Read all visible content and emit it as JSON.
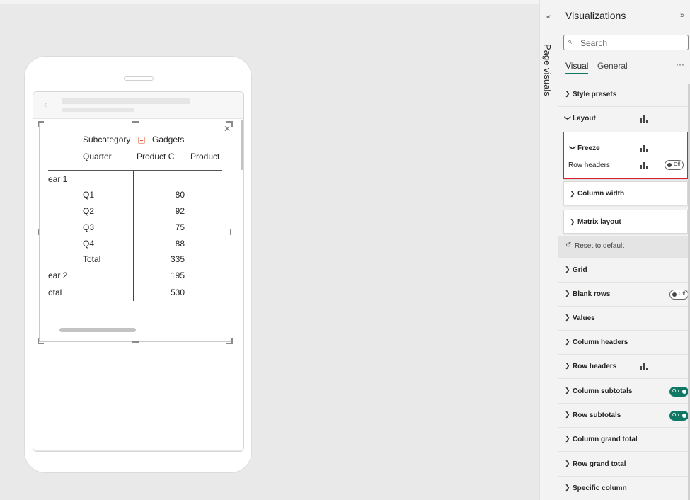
{
  "canvas": {
    "matrix": {
      "subcategory_label": "Subcategory",
      "subcategory_value": "Gadgets",
      "row_header_label": "Quarter",
      "columns": [
        "Product C",
        "Product"
      ],
      "rows": [
        {
          "label": "ear 1",
          "value": ""
        },
        {
          "label": "Q1",
          "value": "80"
        },
        {
          "label": "Q2",
          "value": "92"
        },
        {
          "label": "Q3",
          "value": "75"
        },
        {
          "label": "Q4",
          "value": "88"
        },
        {
          "label": "Total",
          "value": "335"
        },
        {
          "label": "ear 2",
          "value": "195"
        },
        {
          "label": "otal",
          "value": "530"
        }
      ]
    }
  },
  "rail": {
    "label": "Page visuals"
  },
  "pane": {
    "title": "Visualizations",
    "search_placeholder": "Search",
    "tabs": [
      "Visual",
      "General"
    ],
    "more": "···",
    "sections": {
      "style_presets": "Style presets",
      "layout": "Layout",
      "freeze": "Freeze",
      "row_headers_freeze": "Row headers",
      "column_width": "Column width",
      "matrix_layout": "Matrix layout",
      "reset": "Reset to default",
      "grid": "Grid",
      "blank_rows": "Blank rows",
      "values": "Values",
      "column_headers": "Column headers",
      "row_headers": "Row headers",
      "column_subtotals": "Column subtotals",
      "row_subtotals": "Row subtotals",
      "column_grand_total": "Column grand total",
      "row_grand_total": "Row grand total",
      "specific_column": "Specific column"
    },
    "toggles": {
      "off": "Off",
      "on": "On"
    }
  },
  "colors": {
    "accent": "#117865",
    "highlight": "#d9202f"
  }
}
